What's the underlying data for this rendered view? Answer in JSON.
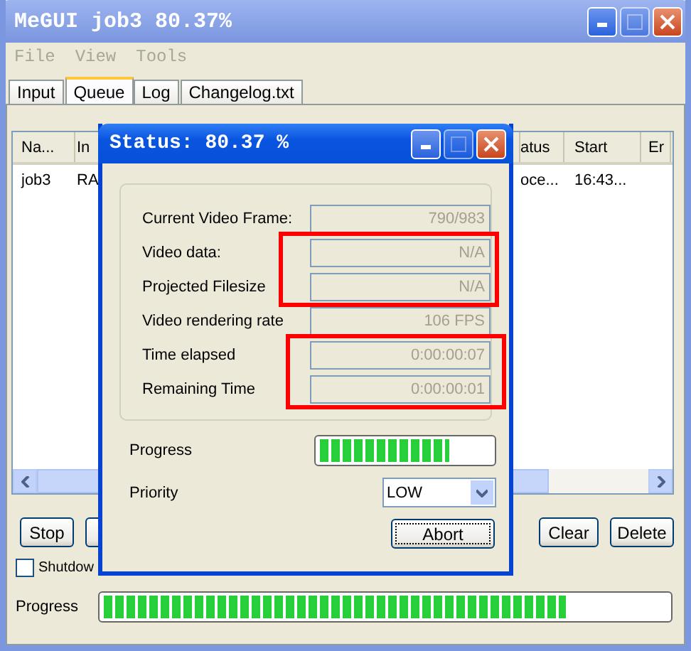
{
  "window": {
    "title": "MeGUI job3 80.37%"
  },
  "menu": [
    "File",
    "View",
    "Tools"
  ],
  "tabs": [
    {
      "label": "Input",
      "selected": false
    },
    {
      "label": "Queue",
      "selected": true
    },
    {
      "label": "Log",
      "selected": false
    },
    {
      "label": "Changelog.txt",
      "selected": false
    }
  ],
  "queue": {
    "columns": [
      "Na...",
      "In",
      "atus",
      "Start",
      "Er"
    ],
    "rows": [
      {
        "cells": [
          "job3",
          "RA",
          "oce...",
          "16:43...",
          ""
        ]
      }
    ]
  },
  "buttons_left": [
    "Stop"
  ],
  "buttons_right": [
    "Clear",
    "Delete"
  ],
  "shutdown": {
    "label": "Shutdow",
    "checked": false
  },
  "progress": {
    "label": "Progress",
    "level": 0.82
  },
  "dialog": {
    "title": "Status: 80.37 %",
    "fields": [
      {
        "label": "Current Video Frame:",
        "value": "790/983",
        "highlighted": false
      },
      {
        "label": "Video data:",
        "value": "N/A",
        "highlighted": true
      },
      {
        "label": "Projected Filesize",
        "value": "N/A",
        "highlighted": true
      },
      {
        "label": "Video rendering rate",
        "value": "106 FPS",
        "highlighted": false
      },
      {
        "label": "Time elapsed",
        "value": "0:00:00:07",
        "highlighted": true
      },
      {
        "label": "Remaining Time",
        "value": "0:00:00:01",
        "highlighted": true
      }
    ],
    "progress": {
      "label": "Progress",
      "level": 0.76
    },
    "priority": {
      "label": "Priority",
      "value": "LOW"
    },
    "abort": "Abort"
  }
}
